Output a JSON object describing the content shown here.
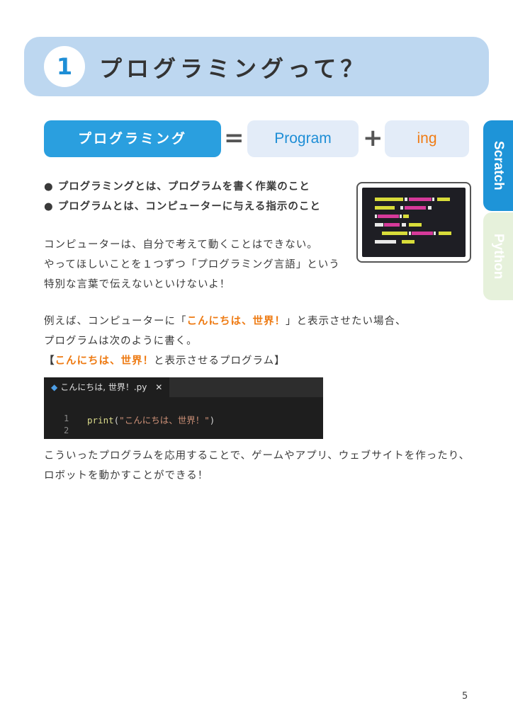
{
  "header": {
    "number": "1",
    "title": "プログラミングって？"
  },
  "tabs": {
    "scratch": "Scratch",
    "python": "Python"
  },
  "equation": {
    "left": "プログラミング",
    "eq": "=",
    "mid": "Program",
    "plus": "+",
    "right": "ing"
  },
  "bullets": [
    "● プログラミングとは、プログラムを書く作業のこと",
    "● プログラムとは、コンピューターに与える指示のこと"
  ],
  "para1": [
    "コンピューターは、自分で考えて動くことはできない。",
    "やってほしいことを１つずつ「プログラミング言語」という",
    "特別な言葉で伝えないといけないよ！"
  ],
  "para2": {
    "line1_a": "例えば、コンピューターに「",
    "line1_b": "こんにちは、世界！",
    "line1_c": "」と表示させたい場合、",
    "line2": "プログラムは次のように書く。",
    "line3_a": "【",
    "line3_b": "こんにちは、世界！",
    "line3_c": "と表示させるプログラム】"
  },
  "editor": {
    "tab_label": "こんにちは, 世界！.py",
    "close": "✕",
    "line_numbers": [
      "1",
      "2"
    ],
    "code_fn": "print",
    "code_open": "(",
    "code_str": "\"こんにちは、世界！\"",
    "code_close": ")"
  },
  "para3": [
    "こういったプログラムを応用することで、ゲームやアプリ、ウェブサイトを作ったり、",
    "ロボットを動かすことができる！"
  ],
  "page_number": "5",
  "colors": {
    "accent_blue": "#1e94d8",
    "header_bg": "#bdd7f0",
    "orange": "#ee7a12"
  }
}
